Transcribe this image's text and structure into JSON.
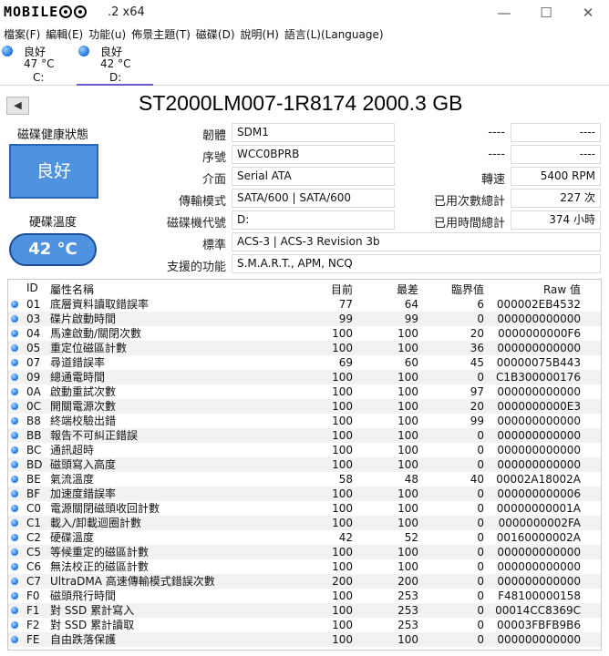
{
  "window": {
    "logo_text": "MOBILE",
    "title": ".2 x64",
    "controls": [
      "—",
      "☐",
      "✕"
    ]
  },
  "menu": [
    "檔案(F)",
    "編輯(E)",
    "功能(u)",
    "佈景主題(T)",
    "磁碟(D)",
    "說明(H)",
    "語言(L)(Language)"
  ],
  "drives": [
    {
      "status": "良好",
      "temp": "47 °C",
      "letter": "C:"
    },
    {
      "status": "良好",
      "temp": "42 °C",
      "letter": "D:"
    }
  ],
  "disk": {
    "model": "ST2000LM007-1R8174 2000.3 GB",
    "health_label": "磁碟健康狀態",
    "health_value": "良好",
    "temp_label": "硬碟溫度",
    "temp_value": "42 °C",
    "fields": {
      "firmware": {
        "label": "韌體",
        "value": "SDM1"
      },
      "serial": {
        "label": "序號",
        "value": "WCC0BPRB"
      },
      "interface": {
        "label": "介面",
        "value": "Serial ATA"
      },
      "transfer": {
        "label": "傳輸模式",
        "value": "SATA/600 | SATA/600"
      },
      "drive_letter": {
        "label": "磁碟機代號",
        "value": "D:"
      },
      "standard": {
        "label": "標準",
        "value": "ACS-3 | ACS-3 Revision 3b"
      },
      "features": {
        "label": "支援的功能",
        "value": "S.M.A.R.T., APM, NCQ"
      }
    },
    "right_fields": {
      "blank1": {
        "label": "----",
        "value": "----"
      },
      "blank2": {
        "label": "----",
        "value": "----"
      },
      "rpm": {
        "label": "轉速",
        "value": "5400 RPM"
      },
      "power_count": {
        "label": "已用次數總計",
        "value": "227 次"
      },
      "power_hours": {
        "label": "已用時間總計",
        "value": "374 小時"
      }
    }
  },
  "smart": {
    "headers": {
      "id": "ID",
      "name": "屬性名稱",
      "current": "目前",
      "worst": "最差",
      "threshold": "臨界值",
      "raw": "Raw 值"
    },
    "rows": [
      {
        "id": "01",
        "name": "底層資料讀取錯誤率",
        "current": "77",
        "worst": "64",
        "threshold": "6",
        "raw": "000002EB4532"
      },
      {
        "id": "03",
        "name": "碟片啟動時間",
        "current": "99",
        "worst": "99",
        "threshold": "0",
        "raw": "000000000000"
      },
      {
        "id": "04",
        "name": "馬達啟動/關閉次數",
        "current": "100",
        "worst": "100",
        "threshold": "20",
        "raw": "0000000000F6"
      },
      {
        "id": "05",
        "name": "重定位磁區計數",
        "current": "100",
        "worst": "100",
        "threshold": "36",
        "raw": "000000000000"
      },
      {
        "id": "07",
        "name": "尋道錯誤率",
        "current": "69",
        "worst": "60",
        "threshold": "45",
        "raw": "00000075B443"
      },
      {
        "id": "09",
        "name": "總通電時間",
        "current": "100",
        "worst": "100",
        "threshold": "0",
        "raw": "C1B300000176"
      },
      {
        "id": "0A",
        "name": "啟動重試次數",
        "current": "100",
        "worst": "100",
        "threshold": "97",
        "raw": "000000000000"
      },
      {
        "id": "0C",
        "name": "開關電源次數",
        "current": "100",
        "worst": "100",
        "threshold": "20",
        "raw": "0000000000E3"
      },
      {
        "id": "B8",
        "name": "終端校驗出錯",
        "current": "100",
        "worst": "100",
        "threshold": "99",
        "raw": "000000000000"
      },
      {
        "id": "BB",
        "name": "報告不可糾正錯誤",
        "current": "100",
        "worst": "100",
        "threshold": "0",
        "raw": "000000000000"
      },
      {
        "id": "BC",
        "name": "通訊超時",
        "current": "100",
        "worst": "100",
        "threshold": "0",
        "raw": "000000000000"
      },
      {
        "id": "BD",
        "name": "磁頭寫入高度",
        "current": "100",
        "worst": "100",
        "threshold": "0",
        "raw": "000000000000"
      },
      {
        "id": "BE",
        "name": "氣流溫度",
        "current": "58",
        "worst": "48",
        "threshold": "40",
        "raw": "00002A18002A"
      },
      {
        "id": "BF",
        "name": "加速度錯誤率",
        "current": "100",
        "worst": "100",
        "threshold": "0",
        "raw": "000000000006"
      },
      {
        "id": "C0",
        "name": "電源關閉磁頭收回計數",
        "current": "100",
        "worst": "100",
        "threshold": "0",
        "raw": "00000000001A"
      },
      {
        "id": "C1",
        "name": "載入/卸載迴圈計數",
        "current": "100",
        "worst": "100",
        "threshold": "0",
        "raw": "0000000002FA"
      },
      {
        "id": "C2",
        "name": "硬碟溫度",
        "current": "42",
        "worst": "52",
        "threshold": "0",
        "raw": "00160000002A"
      },
      {
        "id": "C5",
        "name": "等候重定的磁區計數",
        "current": "100",
        "worst": "100",
        "threshold": "0",
        "raw": "000000000000"
      },
      {
        "id": "C6",
        "name": "無法校正的磁區計數",
        "current": "100",
        "worst": "100",
        "threshold": "0",
        "raw": "000000000000"
      },
      {
        "id": "C7",
        "name": "UltraDMA 高速傳輸模式錯誤次數",
        "current": "200",
        "worst": "200",
        "threshold": "0",
        "raw": "000000000000"
      },
      {
        "id": "F0",
        "name": "磁頭飛行時間",
        "current": "100",
        "worst": "253",
        "threshold": "0",
        "raw": "F48100000158"
      },
      {
        "id": "F1",
        "name": "對 SSD 累計寫入",
        "current": "100",
        "worst": "253",
        "threshold": "0",
        "raw": "00014CC8369C"
      },
      {
        "id": "F2",
        "name": "對 SSD 累計讀取",
        "current": "100",
        "worst": "253",
        "threshold": "0",
        "raw": "00003FBFB9B6"
      },
      {
        "id": "FE",
        "name": "自由跌落保護",
        "current": "100",
        "worst": "100",
        "threshold": "0",
        "raw": "000000000000"
      }
    ]
  }
}
